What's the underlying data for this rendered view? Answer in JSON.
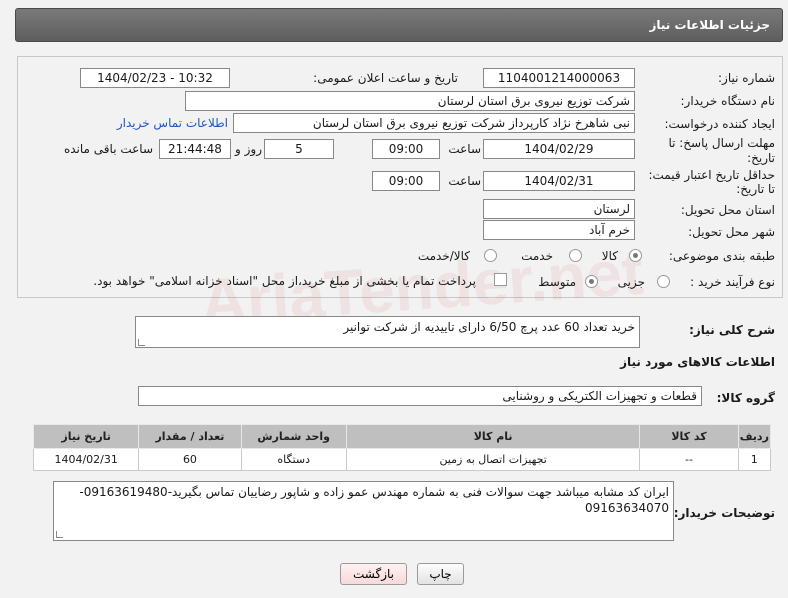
{
  "header": {
    "title": "جزئیات اطلاعات نیاز"
  },
  "form": {
    "need_number_label": "شماره نیاز:",
    "need_number": "1104001214000063",
    "announce_label": "تاریخ و ساعت اعلان عمومی:",
    "announce_value": "1404/02/23 - 10:32",
    "buyer_org_label": "نام دستگاه خریدار:",
    "buyer_org": "شرکت توزیع نیروی برق استان لرستان",
    "creator_label": "ایجاد کننده درخواست:",
    "creator": "نبی شاهرخ نژاد کارپرداز شرکت توزیع نیروی برق استان لرستان",
    "contact_link": "اطلاعات تماس خریدار",
    "deadline_label_1": "مهلت ارسال پاسخ: تا",
    "deadline_label_2": "تاریخ:",
    "deadline_date": "1404/02/29",
    "time_label": "ساعت",
    "deadline_time": "09:00",
    "days_value": "5",
    "days_label": "روز و",
    "remaining_value": "21:44:48",
    "remaining_label": "ساعت باقی مانده",
    "validity_label_1": "حداقل تاریخ اعتبار قیمت:",
    "validity_label_2": "تا تاریخ:",
    "validity_date": "1404/02/31",
    "validity_time": "09:00",
    "province_label": "استان محل تحویل:",
    "province": "لرستان",
    "city_label": "شهر محل تحویل:",
    "city": "خرم آباد",
    "category_label": "طبقه بندی موضوعی:",
    "category_options": [
      "کالا",
      "خدمت",
      "کالا/خدمت"
    ],
    "category_selected": 0,
    "process_label": "نوع فرآیند خرید :",
    "process_options": [
      "جزیی",
      "متوسط"
    ],
    "process_selected": 1,
    "payment_text": "پرداخت تمام یا بخشی از مبلغ خرید،از محل \"اسناد خزانه اسلامی\" خواهد بود."
  },
  "description": {
    "label": "شرح کلی نیاز:",
    "value": "خرید تعداد 60 عدد پرچ 6/50 دارای تاییدیه از شرکت توانیر"
  },
  "goods": {
    "title": "اطلاعات کالاهای مورد نیاز",
    "group_label": "گروه کالا:",
    "group_value": "قطعات و تجهیزات الکتریکی و روشنایی",
    "columns": [
      "ردیف",
      "کد کالا",
      "نام کالا",
      "واحد شمارش",
      "تعداد / مقدار",
      "تاریخ نیاز"
    ],
    "rows": [
      [
        "1",
        "--",
        "تجهیزات اتصال به زمین",
        "دستگاه",
        "60",
        "1404/02/31"
      ]
    ]
  },
  "buyer_notes": {
    "label": "توضیحات خریدار:",
    "value": "ایران کد مشابه میباشد جهت سوالات فنی به شماره  مهندس عمو زاده و شاپور رضاییان  تماس بگیرید-09163619480-09163634070"
  },
  "buttons": {
    "print": "چاپ",
    "back": "بازگشت"
  },
  "watermark": "AriaTender.net",
  "colors": {
    "header_bg": "#666666",
    "link": "#1f56c2",
    "back_button_bg": "#fde9e9"
  }
}
